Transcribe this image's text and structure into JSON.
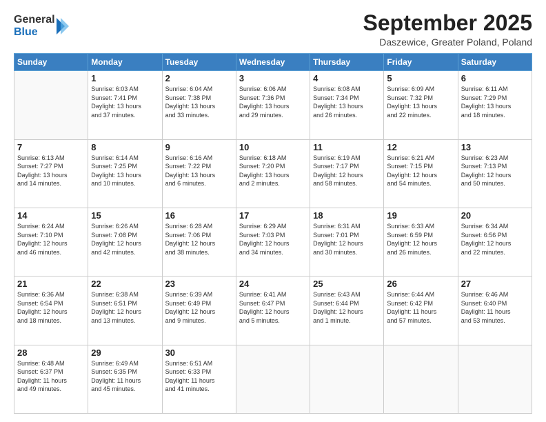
{
  "logo": {
    "general": "General",
    "blue": "Blue"
  },
  "header": {
    "title": "September 2025",
    "location": "Daszewice, Greater Poland, Poland"
  },
  "weekdays": [
    "Sunday",
    "Monday",
    "Tuesday",
    "Wednesday",
    "Thursday",
    "Friday",
    "Saturday"
  ],
  "weeks": [
    [
      {
        "day": "",
        "info": ""
      },
      {
        "day": "1",
        "info": "Sunrise: 6:03 AM\nSunset: 7:41 PM\nDaylight: 13 hours\nand 37 minutes."
      },
      {
        "day": "2",
        "info": "Sunrise: 6:04 AM\nSunset: 7:38 PM\nDaylight: 13 hours\nand 33 minutes."
      },
      {
        "day": "3",
        "info": "Sunrise: 6:06 AM\nSunset: 7:36 PM\nDaylight: 13 hours\nand 29 minutes."
      },
      {
        "day": "4",
        "info": "Sunrise: 6:08 AM\nSunset: 7:34 PM\nDaylight: 13 hours\nand 26 minutes."
      },
      {
        "day": "5",
        "info": "Sunrise: 6:09 AM\nSunset: 7:32 PM\nDaylight: 13 hours\nand 22 minutes."
      },
      {
        "day": "6",
        "info": "Sunrise: 6:11 AM\nSunset: 7:29 PM\nDaylight: 13 hours\nand 18 minutes."
      }
    ],
    [
      {
        "day": "7",
        "info": "Sunrise: 6:13 AM\nSunset: 7:27 PM\nDaylight: 13 hours\nand 14 minutes."
      },
      {
        "day": "8",
        "info": "Sunrise: 6:14 AM\nSunset: 7:25 PM\nDaylight: 13 hours\nand 10 minutes."
      },
      {
        "day": "9",
        "info": "Sunrise: 6:16 AM\nSunset: 7:22 PM\nDaylight: 13 hours\nand 6 minutes."
      },
      {
        "day": "10",
        "info": "Sunrise: 6:18 AM\nSunset: 7:20 PM\nDaylight: 13 hours\nand 2 minutes."
      },
      {
        "day": "11",
        "info": "Sunrise: 6:19 AM\nSunset: 7:17 PM\nDaylight: 12 hours\nand 58 minutes."
      },
      {
        "day": "12",
        "info": "Sunrise: 6:21 AM\nSunset: 7:15 PM\nDaylight: 12 hours\nand 54 minutes."
      },
      {
        "day": "13",
        "info": "Sunrise: 6:23 AM\nSunset: 7:13 PM\nDaylight: 12 hours\nand 50 minutes."
      }
    ],
    [
      {
        "day": "14",
        "info": "Sunrise: 6:24 AM\nSunset: 7:10 PM\nDaylight: 12 hours\nand 46 minutes."
      },
      {
        "day": "15",
        "info": "Sunrise: 6:26 AM\nSunset: 7:08 PM\nDaylight: 12 hours\nand 42 minutes."
      },
      {
        "day": "16",
        "info": "Sunrise: 6:28 AM\nSunset: 7:06 PM\nDaylight: 12 hours\nand 38 minutes."
      },
      {
        "day": "17",
        "info": "Sunrise: 6:29 AM\nSunset: 7:03 PM\nDaylight: 12 hours\nand 34 minutes."
      },
      {
        "day": "18",
        "info": "Sunrise: 6:31 AM\nSunset: 7:01 PM\nDaylight: 12 hours\nand 30 minutes."
      },
      {
        "day": "19",
        "info": "Sunrise: 6:33 AM\nSunset: 6:59 PM\nDaylight: 12 hours\nand 26 minutes."
      },
      {
        "day": "20",
        "info": "Sunrise: 6:34 AM\nSunset: 6:56 PM\nDaylight: 12 hours\nand 22 minutes."
      }
    ],
    [
      {
        "day": "21",
        "info": "Sunrise: 6:36 AM\nSunset: 6:54 PM\nDaylight: 12 hours\nand 18 minutes."
      },
      {
        "day": "22",
        "info": "Sunrise: 6:38 AM\nSunset: 6:51 PM\nDaylight: 12 hours\nand 13 minutes."
      },
      {
        "day": "23",
        "info": "Sunrise: 6:39 AM\nSunset: 6:49 PM\nDaylight: 12 hours\nand 9 minutes."
      },
      {
        "day": "24",
        "info": "Sunrise: 6:41 AM\nSunset: 6:47 PM\nDaylight: 12 hours\nand 5 minutes."
      },
      {
        "day": "25",
        "info": "Sunrise: 6:43 AM\nSunset: 6:44 PM\nDaylight: 12 hours\nand 1 minute."
      },
      {
        "day": "26",
        "info": "Sunrise: 6:44 AM\nSunset: 6:42 PM\nDaylight: 11 hours\nand 57 minutes."
      },
      {
        "day": "27",
        "info": "Sunrise: 6:46 AM\nSunset: 6:40 PM\nDaylight: 11 hours\nand 53 minutes."
      }
    ],
    [
      {
        "day": "28",
        "info": "Sunrise: 6:48 AM\nSunset: 6:37 PM\nDaylight: 11 hours\nand 49 minutes."
      },
      {
        "day": "29",
        "info": "Sunrise: 6:49 AM\nSunset: 6:35 PM\nDaylight: 11 hours\nand 45 minutes."
      },
      {
        "day": "30",
        "info": "Sunrise: 6:51 AM\nSunset: 6:33 PM\nDaylight: 11 hours\nand 41 minutes."
      },
      {
        "day": "",
        "info": ""
      },
      {
        "day": "",
        "info": ""
      },
      {
        "day": "",
        "info": ""
      },
      {
        "day": "",
        "info": ""
      }
    ]
  ]
}
